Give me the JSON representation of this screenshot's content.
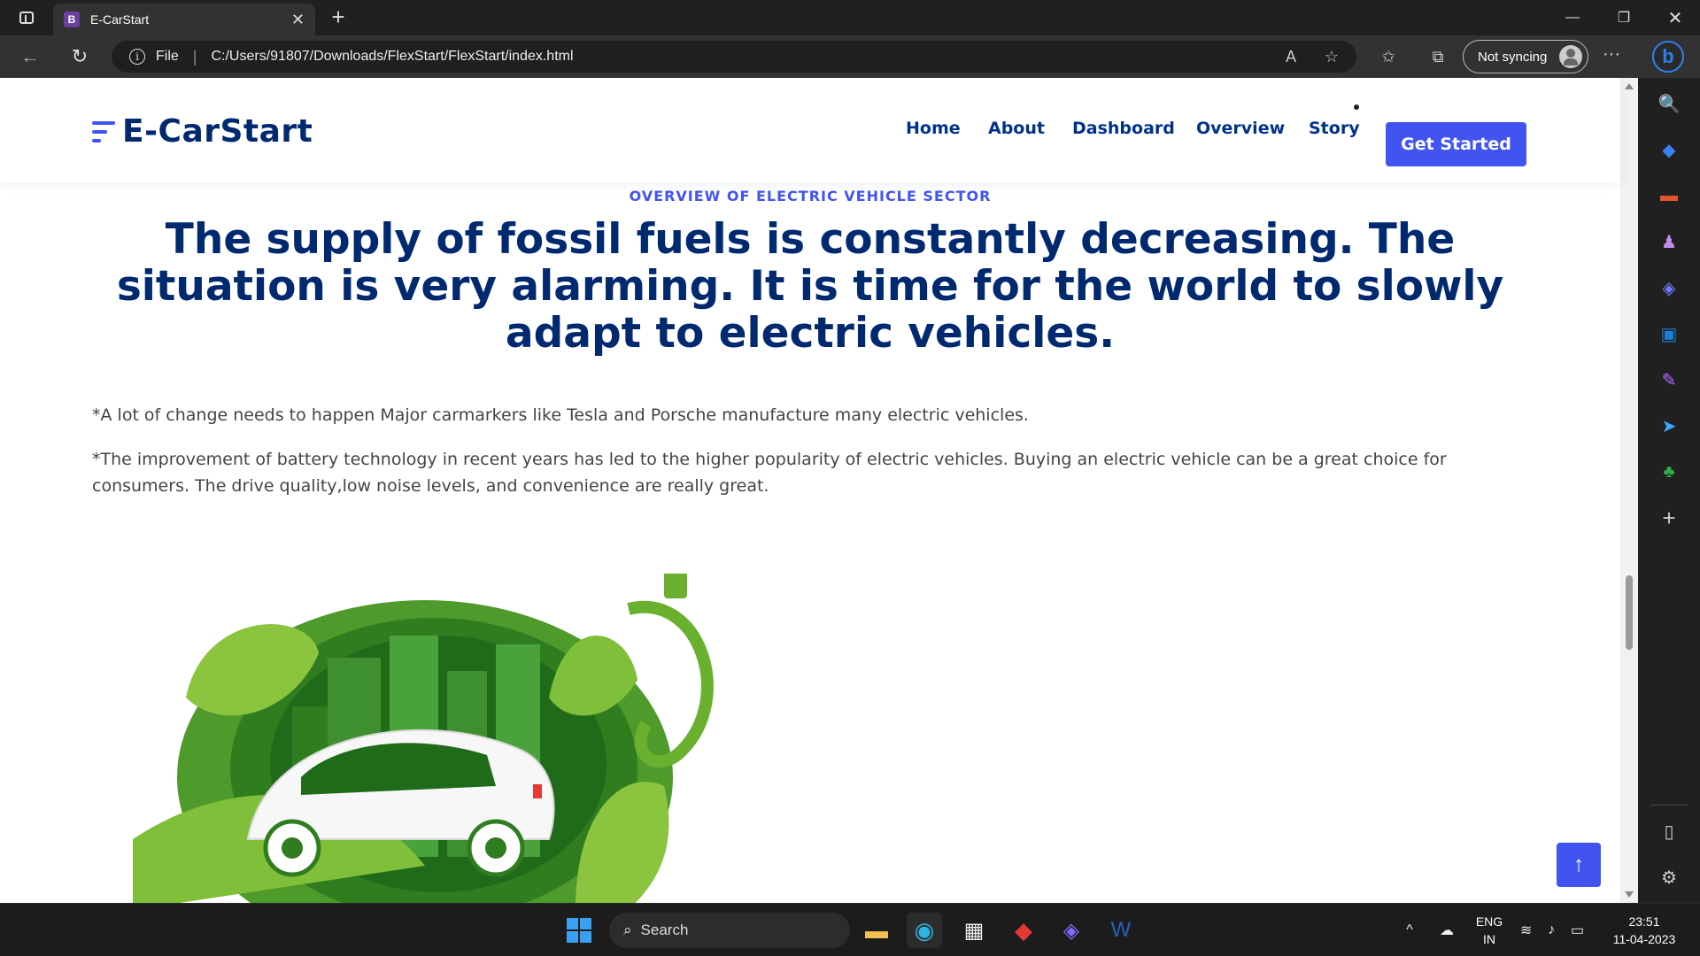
{
  "browser": {
    "tab_title": "E-CarStart",
    "tab_favicon": "B",
    "address_scheme": "File",
    "address_url": "C:/Users/91807/Downloads/FlexStart/FlexStart/index.html",
    "sync_label": "Not syncing"
  },
  "site": {
    "logo": "E-CarStart",
    "nav": [
      "Home",
      "About",
      "Dashboard",
      "Overview",
      "Story"
    ],
    "cta": "Get Started",
    "accent_color": "#4154f1",
    "heading_color": "#012970"
  },
  "section": {
    "eyebrow": "OVERVIEW OF ELECTRIC VEHICLE SECTOR",
    "headline": "The supply of fossil fuels is constantly decreasing. The situation is very alarming. It is time for the world to slowly adapt to electric vehicles.",
    "paragraph1": "*A lot of change needs to happen Major carmarkers like Tesla and Porsche manufacture many electric vehicles.",
    "paragraph2": "*The improvement of battery technology in recent years has led to the higher popularity of electric vehicles. Buying an electric vehicle can be a great choice for consumers. The drive quality,low noise levels, and convenience are really great."
  },
  "taskbar": {
    "search_label": "Search",
    "lang_line1": "ENG",
    "lang_line2": "IN",
    "time": "23:51",
    "date": "11-04-2023"
  }
}
